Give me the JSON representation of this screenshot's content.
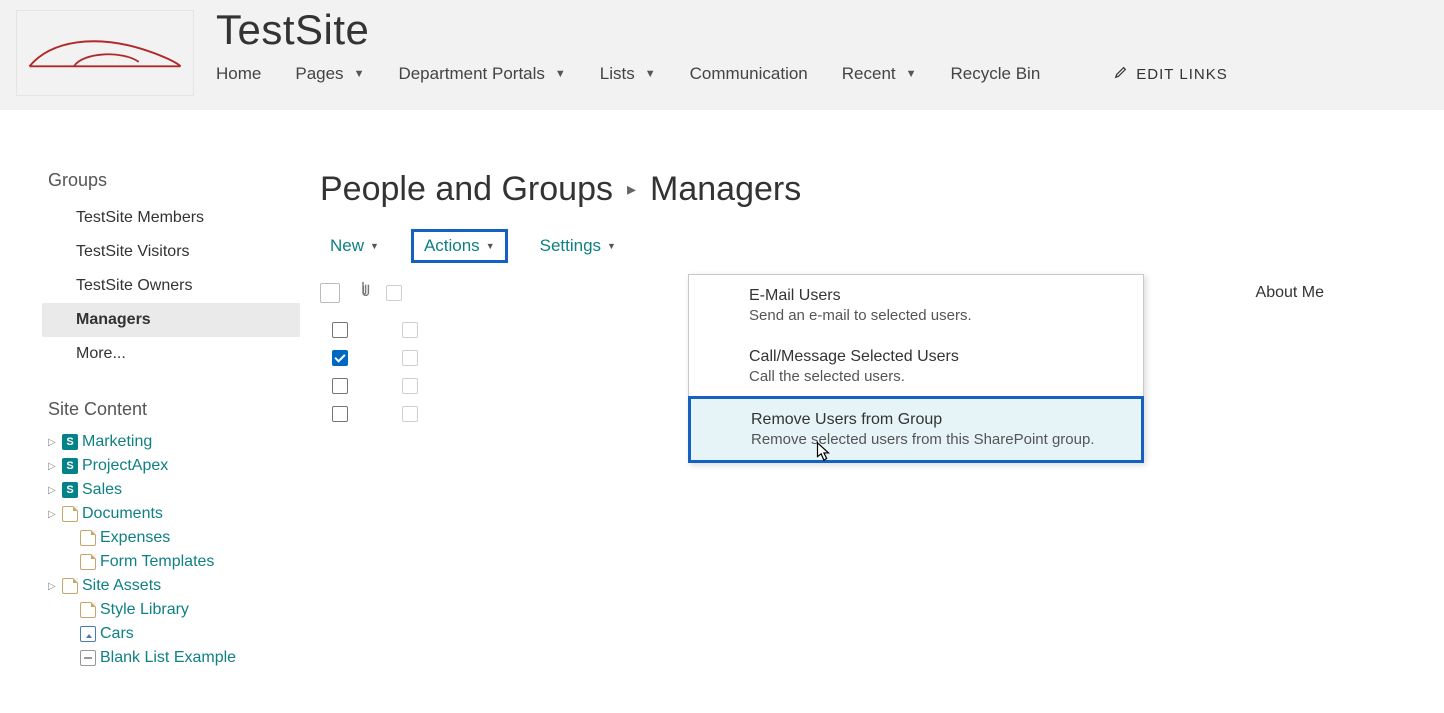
{
  "header": {
    "site_title": "TestSite",
    "nav": [
      {
        "label": "Home",
        "has_dropdown": false
      },
      {
        "label": "Pages",
        "has_dropdown": true
      },
      {
        "label": "Department Portals",
        "has_dropdown": true
      },
      {
        "label": "Lists",
        "has_dropdown": true
      },
      {
        "label": "Communication",
        "has_dropdown": false
      },
      {
        "label": "Recent",
        "has_dropdown": true
      },
      {
        "label": "Recycle Bin",
        "has_dropdown": false
      }
    ],
    "edit_links_label": "EDIT LINKS"
  },
  "sidebar": {
    "groups_heading": "Groups",
    "groups": [
      {
        "label": "TestSite Members",
        "active": false
      },
      {
        "label": "TestSite Visitors",
        "active": false
      },
      {
        "label": "TestSite Owners",
        "active": false
      },
      {
        "label": "Managers",
        "active": true
      },
      {
        "label": "More...",
        "active": false
      }
    ],
    "site_content_heading": "Site Content",
    "tree": [
      {
        "label": "Marketing",
        "icon": "site",
        "expandable": true,
        "indent": false
      },
      {
        "label": "ProjectApex",
        "icon": "site",
        "expandable": true,
        "indent": false
      },
      {
        "label": "Sales",
        "icon": "site",
        "expandable": true,
        "indent": false
      },
      {
        "label": "Documents",
        "icon": "doc",
        "expandable": true,
        "indent": false
      },
      {
        "label": "Expenses",
        "icon": "doc",
        "expandable": false,
        "indent": true
      },
      {
        "label": "Form Templates",
        "icon": "doc",
        "expandable": false,
        "indent": true
      },
      {
        "label": "Site Assets",
        "icon": "doc",
        "expandable": true,
        "indent": false
      },
      {
        "label": "Style Library",
        "icon": "doc",
        "expandable": false,
        "indent": true
      },
      {
        "label": "Cars",
        "icon": "pic",
        "expandable": false,
        "indent": true
      },
      {
        "label": "Blank List Example",
        "icon": "list",
        "expandable": false,
        "indent": true
      }
    ]
  },
  "content": {
    "breadcrumb_parent": "People and Groups",
    "breadcrumb_current": "Managers",
    "toolbar": {
      "new_label": "New",
      "actions_label": "Actions",
      "settings_label": "Settings"
    },
    "columns": {
      "about_me": "About Me"
    },
    "rows": [
      {
        "selected": false
      },
      {
        "selected": true
      },
      {
        "selected": false
      },
      {
        "selected": false
      }
    ]
  },
  "actions_menu": [
    {
      "title": "E-Mail Users",
      "desc": "Send an e-mail to selected users.",
      "highlighted": false
    },
    {
      "title": "Call/Message Selected Users",
      "desc": "Call the selected users.",
      "highlighted": false
    },
    {
      "title": "Remove Users from Group",
      "desc": "Remove selected users from this SharePoint group.",
      "highlighted": true
    }
  ]
}
